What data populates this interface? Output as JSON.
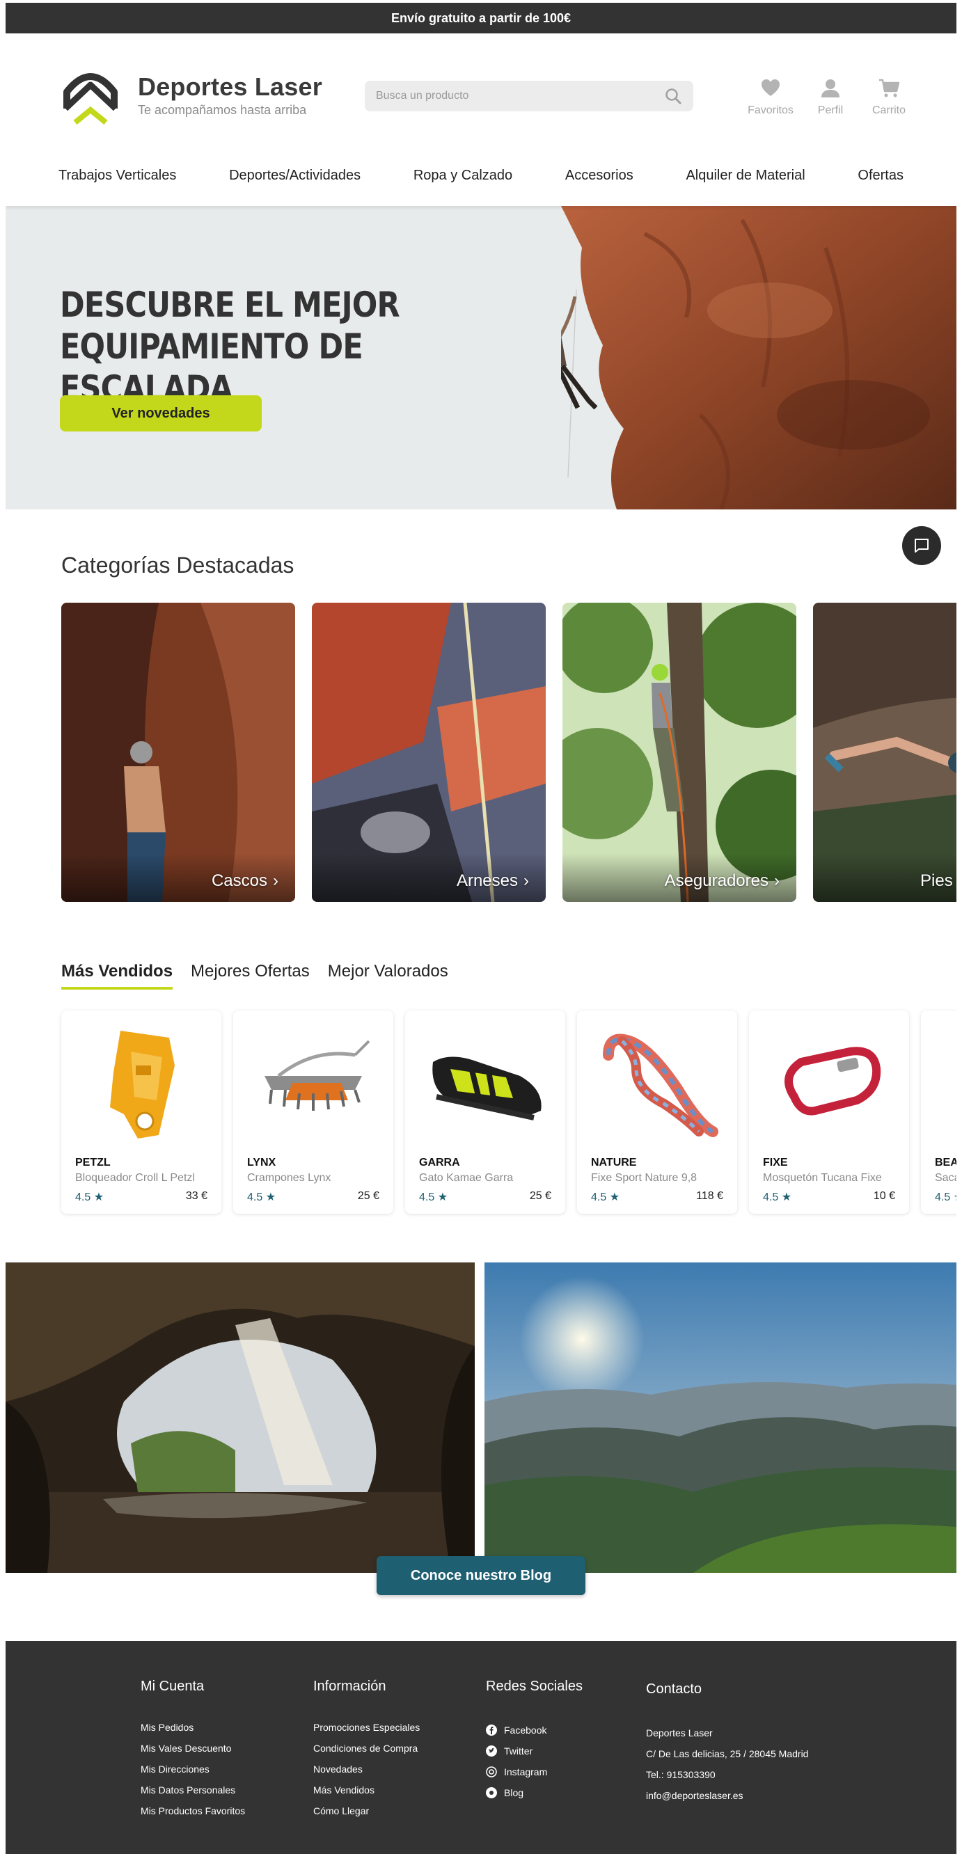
{
  "topbar": {
    "text": "Envío gratuito a partir de 100€"
  },
  "header": {
    "brand_name": "Deportes Laser",
    "tagline": "Te acompañamos hasta arriba",
    "search_placeholder": "Busca un producto",
    "icons": [
      {
        "icon": "heart-icon",
        "label": "Favoritos"
      },
      {
        "icon": "user-icon",
        "label": "Perfil"
      },
      {
        "icon": "cart-icon",
        "label": "Carrito"
      }
    ]
  },
  "nav": {
    "items": [
      "Trabajos Verticales",
      "Deportes/Actividades",
      "Ropa y Calzado",
      "Accesorios",
      "Alquiler de Material",
      "Ofertas"
    ]
  },
  "hero": {
    "title_line1": "DESCUBRE EL MEJOR",
    "title_line2": "EQUIPAMIENTO DE ESCALADA",
    "cta": "Ver novedades"
  },
  "categories": {
    "title": "Categorías Destacadas",
    "items": [
      {
        "label": "Cascos"
      },
      {
        "label": "Arneses"
      },
      {
        "label": "Aseguradores"
      },
      {
        "label": "Pies de Gato"
      }
    ]
  },
  "product_tabs": {
    "items": [
      "Más Vendidos",
      "Mejores Ofertas",
      "Mejor Valorados"
    ],
    "active_index": 0
  },
  "products": [
    {
      "brand": "PETZL",
      "name": "Bloqueador Croll L Petzl",
      "rating": "4.5 ★",
      "price": "33 €"
    },
    {
      "brand": "LYNX",
      "name": "Crampones Lynx",
      "rating": "4.5 ★",
      "price": "25 €"
    },
    {
      "brand": "GARRA",
      "name": "Gato Kamae Garra",
      "rating": "4.5 ★",
      "price": "25 €"
    },
    {
      "brand": "NATURE",
      "name": "Fixe Sport Nature 9,8",
      "rating": "4.5 ★",
      "price": "118 €"
    },
    {
      "brand": "FIXE",
      "name": "Mosquetón Tucana Fixe",
      "rating": "4.5 ★",
      "price": "10 €"
    },
    {
      "brand": "BEA",
      "name": "Saca",
      "rating": "4.5 ★",
      "price": ""
    }
  ],
  "blog": {
    "cta": "Conoce nuestro Blog"
  },
  "footer": {
    "columns": [
      {
        "title": "Mi Cuenta",
        "links": [
          "Mis Pedidos",
          "Mis Vales Descuento",
          "Mis Direcciones",
          "Mis Datos Personales",
          "Mis Productos Favoritos"
        ]
      },
      {
        "title": "Información",
        "links": [
          "Promociones Especiales",
          "Condiciones de Compra",
          "Novedades",
          "Más Vendidos",
          "Cómo Llegar"
        ]
      },
      {
        "title": "Redes Sociales",
        "links": [
          "Facebook",
          "Twitter",
          "Instagram",
          "Blog"
        ]
      },
      {
        "title": "Contacto",
        "links": [
          "Deportes Laser",
          "C/ De Las delicias, 25 / 28045 Madrid",
          "Tel.: 915303390",
          "info@deporteslaser.es"
        ]
      }
    ]
  },
  "colors": {
    "accent": "#c4d81b",
    "primary": "#1e5f72",
    "dark": "#333333"
  }
}
